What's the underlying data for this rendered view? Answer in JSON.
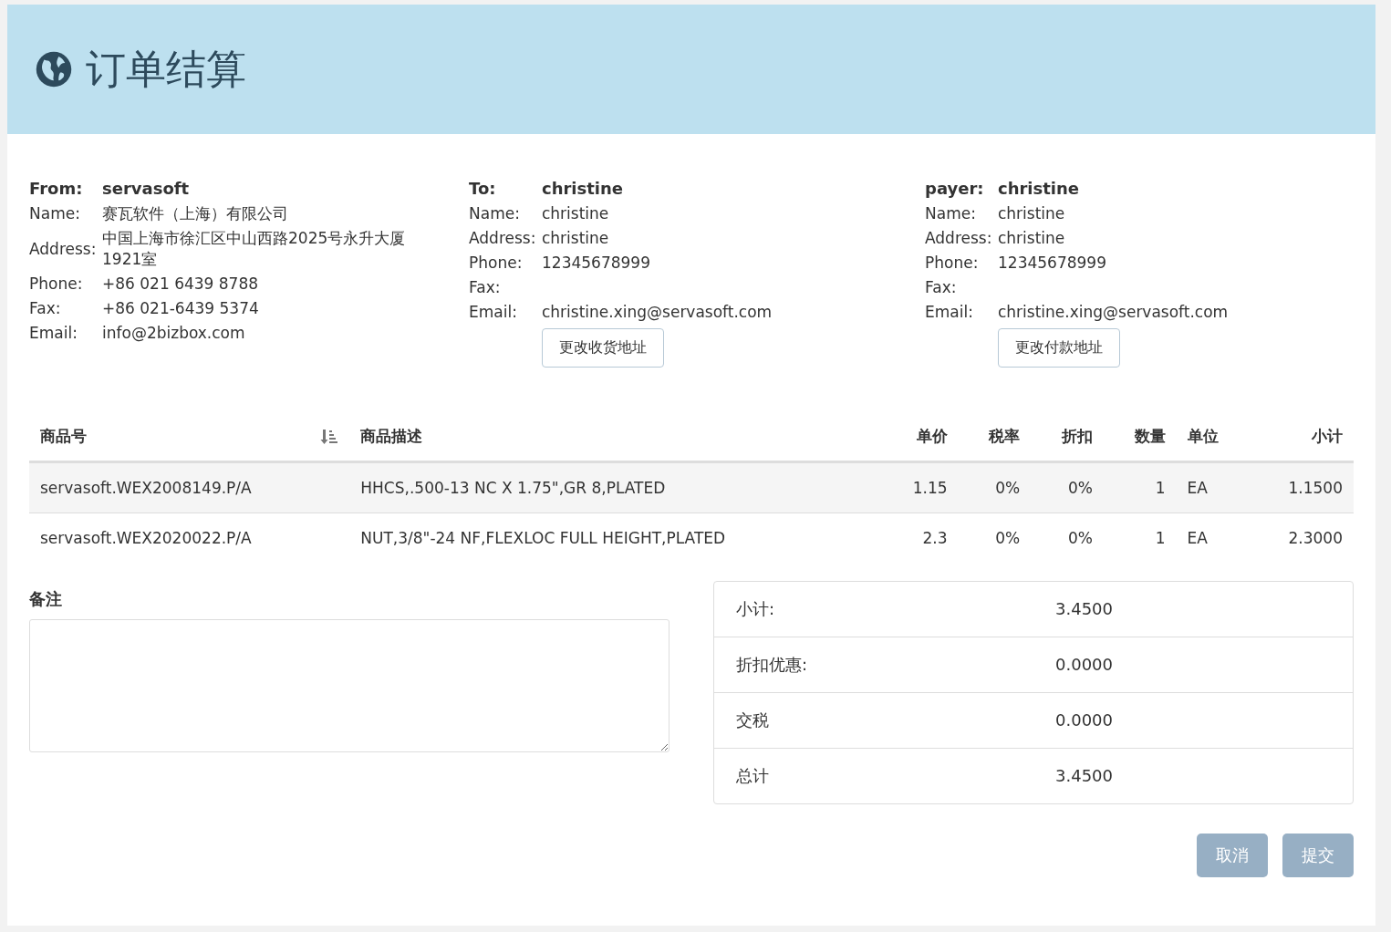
{
  "header": {
    "title": "订单结算"
  },
  "parties": [
    {
      "label": "From:",
      "name": "servasoft",
      "fields": [
        {
          "label": "Name:",
          "value": "赛瓦软件（上海）有限公司"
        },
        {
          "label": "Address:",
          "value": "中国上海市徐汇区中山西路2025号永升大厦1921室"
        },
        {
          "label": "Phone:",
          "value": "+86 021 6439 8788"
        },
        {
          "label": "Fax:",
          "value": "+86 021-6439 5374"
        },
        {
          "label": "Email:",
          "value": "info@2bizbox.com"
        }
      ]
    },
    {
      "label": "To:",
      "name": "christine",
      "fields": [
        {
          "label": "Name:",
          "value": "christine"
        },
        {
          "label": "Address:",
          "value": "christine"
        },
        {
          "label": "Phone:",
          "value": "12345678999"
        },
        {
          "label": "Fax:"
        },
        {
          "label": "Email:",
          "value": "christine.xing@servasoft.com"
        }
      ],
      "button": "更改收货地址"
    },
    {
      "label": "payer:",
      "name": "christine",
      "fields": [
        {
          "label": "Name:",
          "value": "christine"
        },
        {
          "label": "Address:",
          "value": "christine"
        },
        {
          "label": "Phone:",
          "value": "12345678999"
        },
        {
          "label": "Fax:"
        },
        {
          "label": "Email:",
          "value": "christine.xing@servasoft.com"
        }
      ],
      "button": "更改付款地址"
    }
  ],
  "table": {
    "columns": [
      {
        "label": "商品号",
        "sortable": true
      },
      {
        "label": "商品描述",
        "sortable": false
      },
      {
        "label": "单价",
        "sortable": false
      },
      {
        "label": "税率",
        "sortable": false
      },
      {
        "label": "折扣",
        "sortable": false
      },
      {
        "label": "数量",
        "sortable": false
      },
      {
        "label": "单位",
        "sortable": false
      },
      {
        "label": "小计",
        "sortable": false
      }
    ],
    "rows": [
      {
        "selected": true,
        "cells": [
          "servasoft.WEX2008149.P/A",
          "HHCS,.500-13 NC X 1.75\",GR 8,PLATED",
          "1.15",
          "0%",
          "0%",
          "1",
          "EA",
          "1.1500"
        ]
      },
      {
        "selected": false,
        "cells": [
          "servasoft.WEX2020022.P/A",
          "NUT,3/8\"-24 NF,FLEXLOC FULL HEIGHT,PLATED",
          "2.3",
          "0%",
          "0%",
          "1",
          "EA",
          "2.3000"
        ]
      }
    ]
  },
  "notes": {
    "label": "备注"
  },
  "summary": [
    {
      "label": "小计:",
      "value": "3.4500"
    },
    {
      "label": "折扣优惠:",
      "value": "0.0000"
    },
    {
      "label": "交税",
      "value": "0.0000"
    },
    {
      "label": "总计",
      "value": "3.4500"
    }
  ],
  "buttons": [
    {
      "label": "取消",
      "disabled": true
    },
    {
      "label": "提交",
      "disabled": true
    }
  ]
}
